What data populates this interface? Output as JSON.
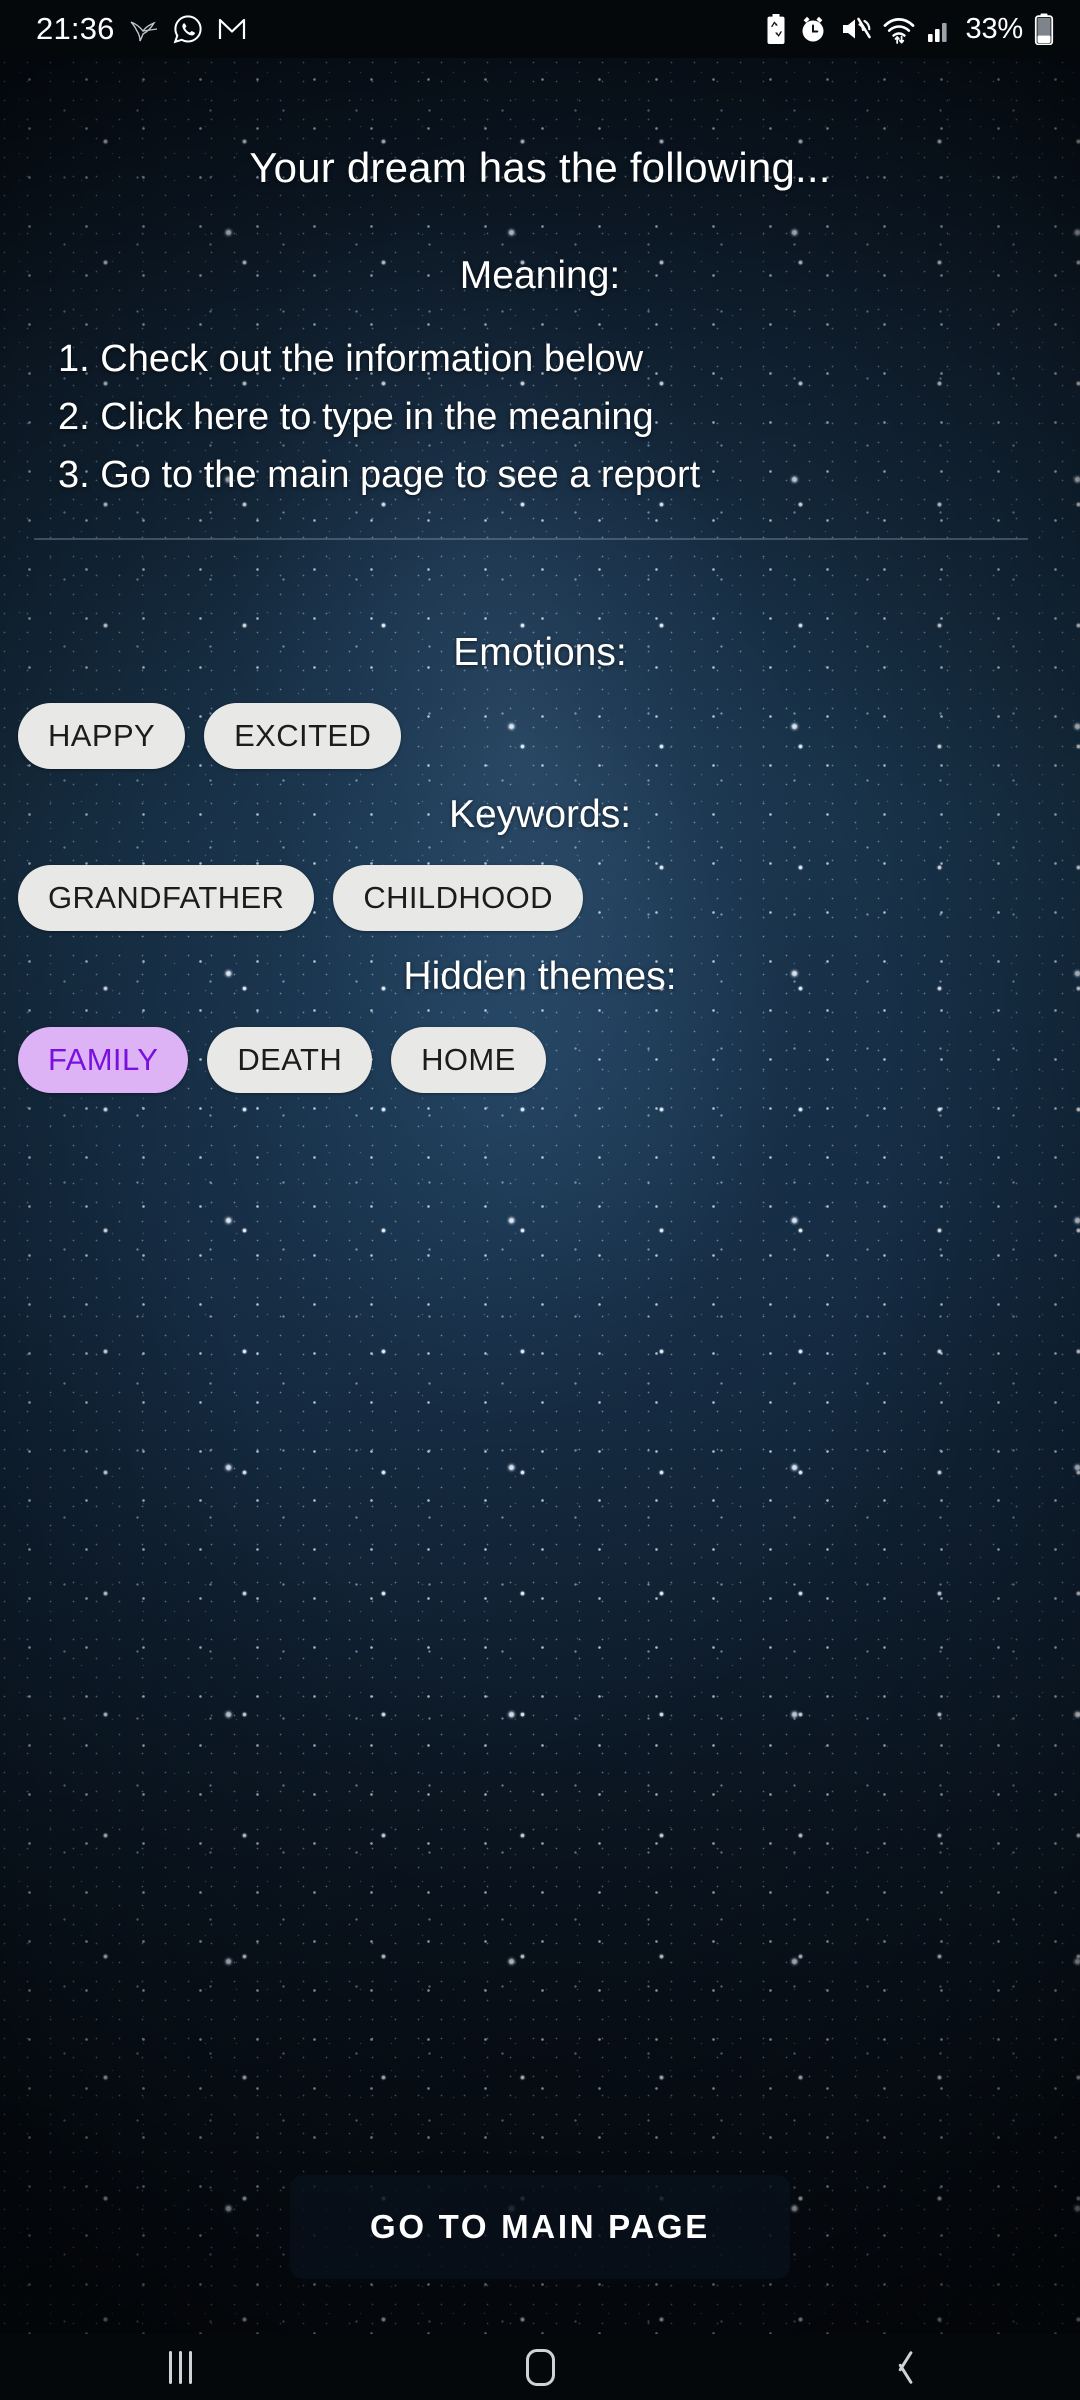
{
  "status_bar": {
    "time": "21:36",
    "battery_percent": "33%",
    "left_icons": [
      "bird-icon",
      "whatsapp-icon",
      "gmail-icon"
    ],
    "right_icons": [
      "battery-saver-icon",
      "alarm-icon",
      "volume-muted-icon",
      "wifi-icon",
      "cellular-signal-icon",
      "battery-icon"
    ]
  },
  "screen": {
    "title": "Your dream has the following...",
    "meaning": {
      "label": "Meaning:",
      "instructions": [
        "1. Check out the information below",
        "2. Click here to type in the meaning",
        "3. Go to the main page to see a report"
      ]
    },
    "emotions": {
      "label": "Emotions:",
      "chips": [
        {
          "text": "HAPPY",
          "selected": false
        },
        {
          "text": "EXCITED",
          "selected": false
        }
      ]
    },
    "keywords": {
      "label": "Keywords:",
      "chips": [
        {
          "text": "GRANDFATHER",
          "selected": false
        },
        {
          "text": "CHILDHOOD",
          "selected": false
        }
      ]
    },
    "hidden_themes": {
      "label": "Hidden themes:",
      "chips": [
        {
          "text": "FAMILY",
          "selected": true
        },
        {
          "text": "DEATH",
          "selected": false
        },
        {
          "text": "HOME",
          "selected": false
        }
      ]
    },
    "primary_button": "GO TO MAIN PAGE"
  },
  "nav_bar": {
    "recents_label": "Recents",
    "home_label": "Home",
    "back_label": "Back"
  },
  "colors": {
    "chip_background": "#e8e8e6",
    "chip_text": "#1c1c1c",
    "chip_selected_background": "#ddb3f5",
    "chip_selected_text": "#7a10e0",
    "text_primary": "#ffffff",
    "status_bar_background": "#05080b",
    "button_background": "rgba(8,16,26,0.80)"
  }
}
